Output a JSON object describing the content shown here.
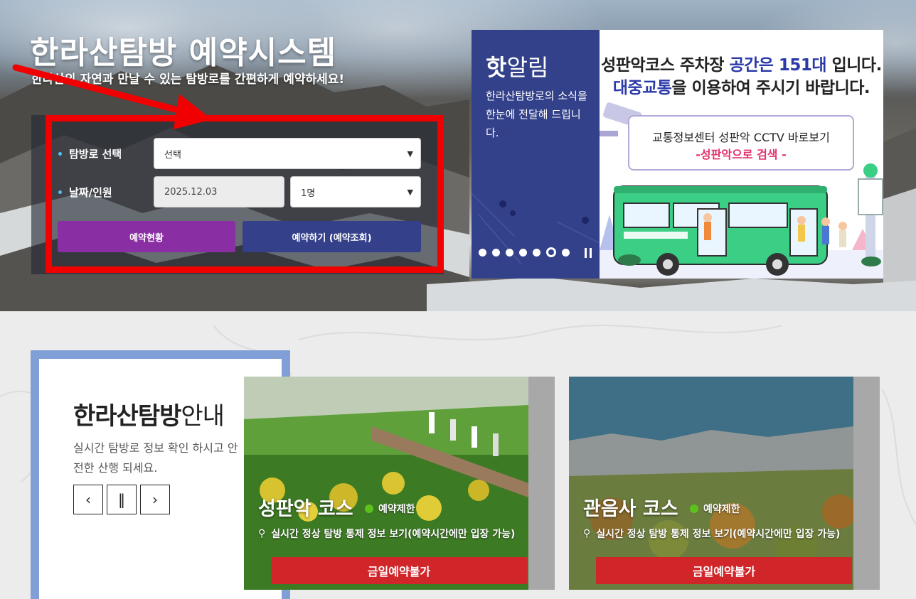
{
  "hero": {
    "title": "한라산탐방 예약시스템",
    "subtitle": "한라산의 자연과 만날 수 있는 탐방로를 간편하게 예약하세요!"
  },
  "booking": {
    "trail_label": "탐방로 선택",
    "trail_value": "선택",
    "date_label": "날짜/인원",
    "date_value": "2025.12.03",
    "people_value": "1명",
    "status_button": "예약현황",
    "reserve_button": "예약하기 (예약조회)"
  },
  "notice": {
    "heading_bold": "핫",
    "heading_rest": "알림",
    "description": "한라산탐방로의 소식을 한눈에 전달해 드립니다.",
    "line1_a": "성판악코스 주차장 ",
    "line1_b": "공간은 151대",
    "line1_c": " 입니다.",
    "line2_a": "대중교통",
    "line2_b": "을 이용하여 주시기 바랍니다.",
    "cctv_line1": "교통정보센터 성판악 CCTV 바로보기",
    "cctv_line2": "-성판악으로 검색 -",
    "slide_count": 7,
    "active_slide": 6
  },
  "guide": {
    "title_bold": "한라산탐방",
    "title_rest": "안내",
    "description": "실시간 탐방로 정보 확인 하시고 안전한 산행 되세요.",
    "prev_icon": "‹",
    "pause_icon": "‖",
    "next_icon": "›"
  },
  "courses": [
    {
      "name": "성판악 코스",
      "status": "예약제한",
      "realtime": "실시간 정상 탐방 통제 정보 보기(예약시간에만 입장 가능)",
      "button": "금일예약불가"
    },
    {
      "name": "관음사 코스",
      "status": "예약제한",
      "realtime": "실시간 정상 탐방 통제 정보 보기(예약시간에만 입장 가능)",
      "button": "금일예약불가"
    }
  ],
  "colors": {
    "brand_navy": "#33418a",
    "purple": "#8a2fa3",
    "red_button": "#d0262a",
    "highlight_frame": "#f00000",
    "status_green": "#5cc21a"
  }
}
